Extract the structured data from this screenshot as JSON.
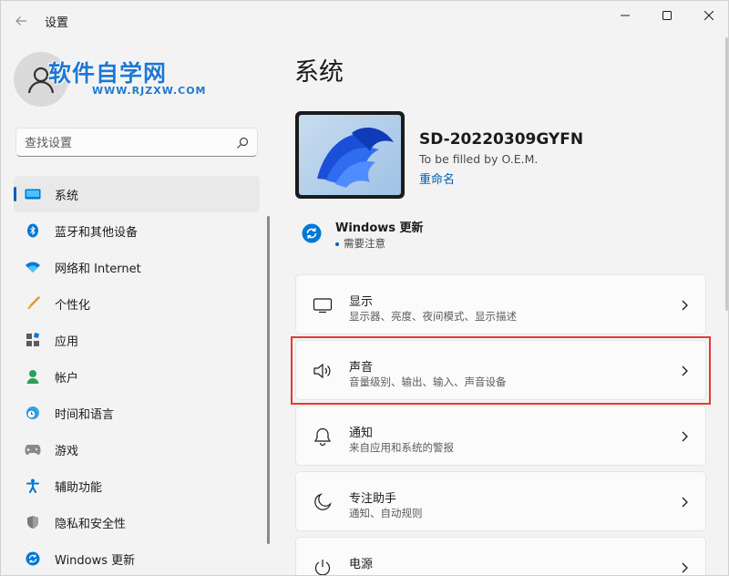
{
  "window": {
    "title": "设置"
  },
  "logo": {
    "main": "软件自学网",
    "sub": "WWW.RJZXW.COM"
  },
  "search": {
    "placeholder": "查找设置"
  },
  "sidebar": {
    "items": [
      {
        "label": "系统",
        "icon": "monitor-icon",
        "active": true
      },
      {
        "label": "蓝牙和其他设备",
        "icon": "bluetooth-icon"
      },
      {
        "label": "网络和 Internet",
        "icon": "wifi-icon"
      },
      {
        "label": "个性化",
        "icon": "brush-icon"
      },
      {
        "label": "应用",
        "icon": "apps-icon"
      },
      {
        "label": "帐户",
        "icon": "person-icon"
      },
      {
        "label": "时间和语言",
        "icon": "clock-globe-icon"
      },
      {
        "label": "游戏",
        "icon": "gamepad-icon"
      },
      {
        "label": "辅助功能",
        "icon": "accessibility-icon"
      },
      {
        "label": "隐私和安全性",
        "icon": "shield-icon"
      },
      {
        "label": "Windows 更新",
        "icon": "update-icon"
      }
    ]
  },
  "main": {
    "title": "系统",
    "device": {
      "name": "SD-20220309GYFN",
      "model": "To be filled by O.E.M.",
      "rename": "重命名"
    },
    "update": {
      "title": "Windows 更新",
      "status": "需要注意"
    },
    "cards": [
      {
        "title": "显示",
        "desc": "显示器、亮度、夜间模式、显示描述",
        "icon": "display-icon"
      },
      {
        "title": "声音",
        "desc": "音量级别、输出、输入、声音设备",
        "icon": "speaker-icon"
      },
      {
        "title": "通知",
        "desc": "来自应用和系统的警报",
        "icon": "bell-icon"
      },
      {
        "title": "专注助手",
        "desc": "通知、自动规则",
        "icon": "moon-icon"
      },
      {
        "title": "电源",
        "desc": "",
        "icon": "power-icon"
      }
    ]
  },
  "colors": {
    "accent": "#005fb8",
    "highlight": "#e53935",
    "logo": "#1f78d1"
  }
}
